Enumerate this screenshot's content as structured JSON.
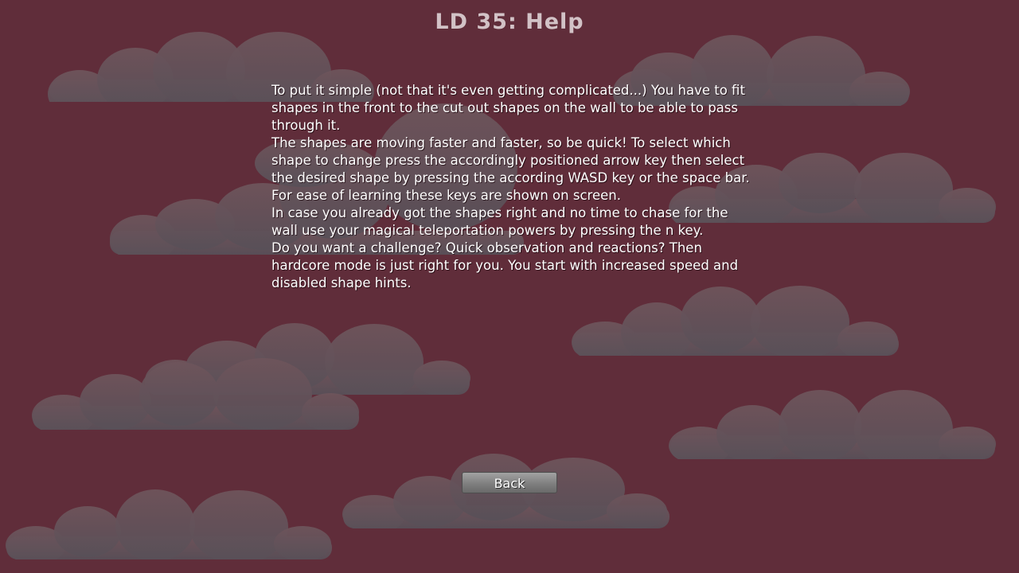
{
  "window": {
    "title": "LD 35: Help"
  },
  "help": {
    "paragraphs": [
      "To put it simple (not that it's even getting complicated...) You have to fit shapes in the front to the cut out shapes on the wall to be able to pass through it.",
      "The shapes are moving faster and faster, so be quick! To select which shape to change press the accordingly positioned arrow key then select the desired shape by pressing the according WASD key or the space bar. For ease of learning these keys are shown on screen.",
      "In case you already got the shapes right and no time to chase for the wall use your magical teleportation powers by pressing the n key.",
      "Do you want a challenge? Quick observation and reactions? Then hardcore mode is just right for you. You start with increased speed and disabled shape hints."
    ]
  },
  "buttons": {
    "back_label": "Back"
  },
  "colors": {
    "background": "#602d3a",
    "cloud": "#6b5158",
    "title_text": "#d2c2c6",
    "body_text": "#ffffff",
    "button": "#8a8a8a"
  }
}
